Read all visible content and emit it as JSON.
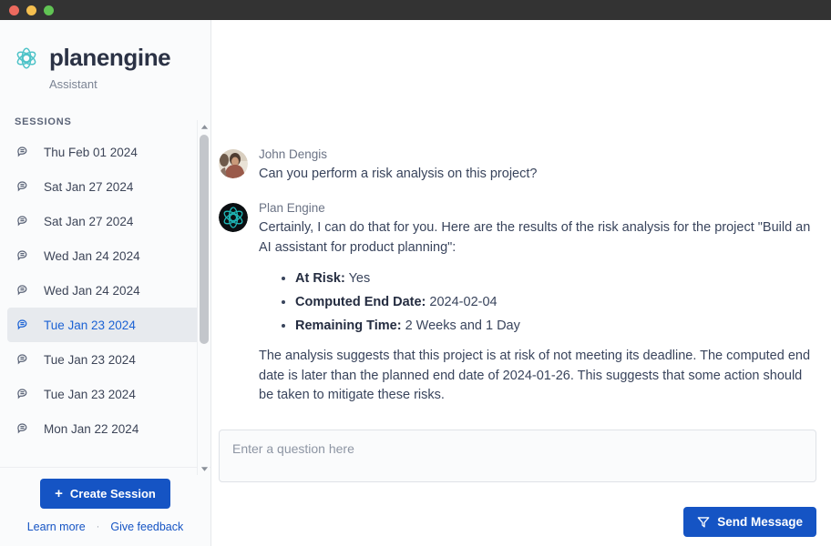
{
  "window": {
    "traffic_lights": [
      {
        "name": "close",
        "color": "#ed6a5e"
      },
      {
        "name": "minimize",
        "color": "#f4bf4f"
      },
      {
        "name": "maximize",
        "color": "#61c454"
      }
    ]
  },
  "sidebar": {
    "brand_name": "planengine",
    "brand_subtitle": "Assistant",
    "logo_icon": "atom-icon",
    "logo_color": "#4ec3c8",
    "sessions_header": "SESSIONS",
    "sessions": [
      {
        "label": "Thu Feb 01 2024",
        "icon": "comment-icon",
        "selected": false
      },
      {
        "label": "Sat Jan 27 2024",
        "icon": "comment-icon",
        "selected": false
      },
      {
        "label": "Sat Jan 27 2024",
        "icon": "comment-icon",
        "selected": false
      },
      {
        "label": "Wed Jan 24 2024",
        "icon": "comment-icon",
        "selected": false
      },
      {
        "label": "Wed Jan 24 2024",
        "icon": "comment-icon",
        "selected": false
      },
      {
        "label": "Tue Jan 23 2024",
        "icon": "comment-icon",
        "selected": true
      },
      {
        "label": "Tue Jan 23 2024",
        "icon": "comment-icon",
        "selected": false
      },
      {
        "label": "Tue Jan 23 2024",
        "icon": "comment-icon",
        "selected": false
      },
      {
        "label": "Mon Jan 22 2024",
        "icon": "comment-icon",
        "selected": false
      }
    ],
    "create_session_label": "Create Session",
    "create_session_icon": "plus-icon",
    "learn_more_label": "Learn more",
    "footer_separator": "·",
    "give_feedback_label": "Give feedback",
    "accent_color": "#1554c4",
    "selected_bg": "#e7eaee"
  },
  "conversation": {
    "messages": [
      {
        "author": "John Dengis",
        "avatar": "user-photo-avatar",
        "paragraphs": [
          "Can you perform a risk analysis on this project?"
        ],
        "bullets": []
      },
      {
        "author": "Plan Engine",
        "avatar": "atom-avatar",
        "paragraphs": [
          "Certainly, I can do that for you. Here are the results of the risk analysis for the project \"Build an AI assistant for product planning\":",
          "The analysis suggests that this project is at risk of not meeting its deadline. The computed end date is later than the planned end date of 2024-01-26. This suggests that some action should be taken to mitigate these risks."
        ],
        "bullets": [
          {
            "label": "At Risk:",
            "value": "Yes"
          },
          {
            "label": "Computed End Date:",
            "value": "2024-02-04"
          },
          {
            "label": "Remaining Time:",
            "value": "2 Weeks and 1 Day"
          }
        ]
      }
    ]
  },
  "composer": {
    "placeholder": "Enter a question here",
    "value": "",
    "send_label": "Send Message",
    "send_icon": "send-icon"
  }
}
